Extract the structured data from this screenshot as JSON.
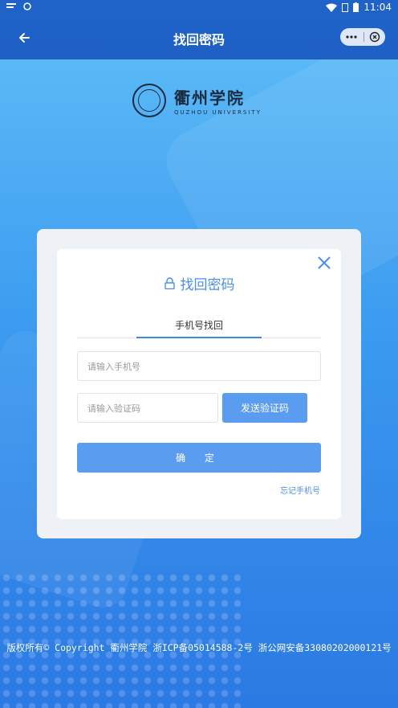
{
  "status": {
    "time": "11:04",
    "icons": [
      "notification-icon",
      "mail-icon",
      "wifi-icon",
      "sim-icon",
      "battery-icon"
    ]
  },
  "header": {
    "title": "找回密码"
  },
  "logo": {
    "cn": "衢州学院",
    "en": "QUZHOU UNIVERSITY"
  },
  "dialog": {
    "title": "找回密码",
    "tab_label": "手机号找回",
    "phone_placeholder": "请输入手机号",
    "code_placeholder": "请输入验证码",
    "send_code_label": "发送验证码",
    "confirm_label": "确 定",
    "forgot_phone_label": "忘记手机号"
  },
  "footer": {
    "text": "版权所有© Copyright 衢州学院 浙ICP备05014588-2号 浙公网安备33080202000121号"
  },
  "colors": {
    "accent": "#3b8be6",
    "button": "#5a9cf0",
    "header": "#1f63c9"
  }
}
